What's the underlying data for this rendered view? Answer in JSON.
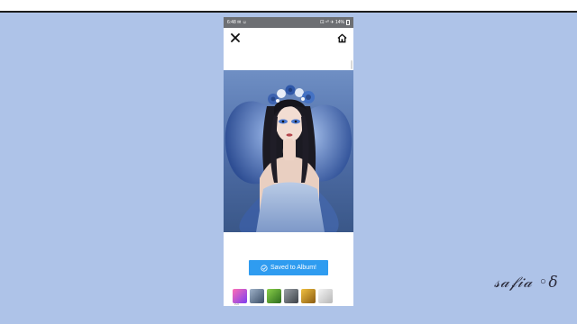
{
  "status_bar": {
    "time": "6:48",
    "left_icons": "✉ ☺",
    "right_text": "⚀ ⁹⁰ ✈ 14%"
  },
  "app_bar": {
    "close_icon": "close-icon",
    "home_icon": "home-icon"
  },
  "save_button": {
    "label": "Saved to Album!",
    "icon": "check-circle-icon",
    "color": "#2f9cf0"
  },
  "ads": {
    "label": "Ad",
    "items": [
      "app-ad-1",
      "app-ad-2",
      "app-ad-3",
      "app-ad-4",
      "app-ad-5",
      "app-ad-6"
    ]
  },
  "signature": "𝓈𝒶𝒻𝒾𝒶 ◦δ"
}
